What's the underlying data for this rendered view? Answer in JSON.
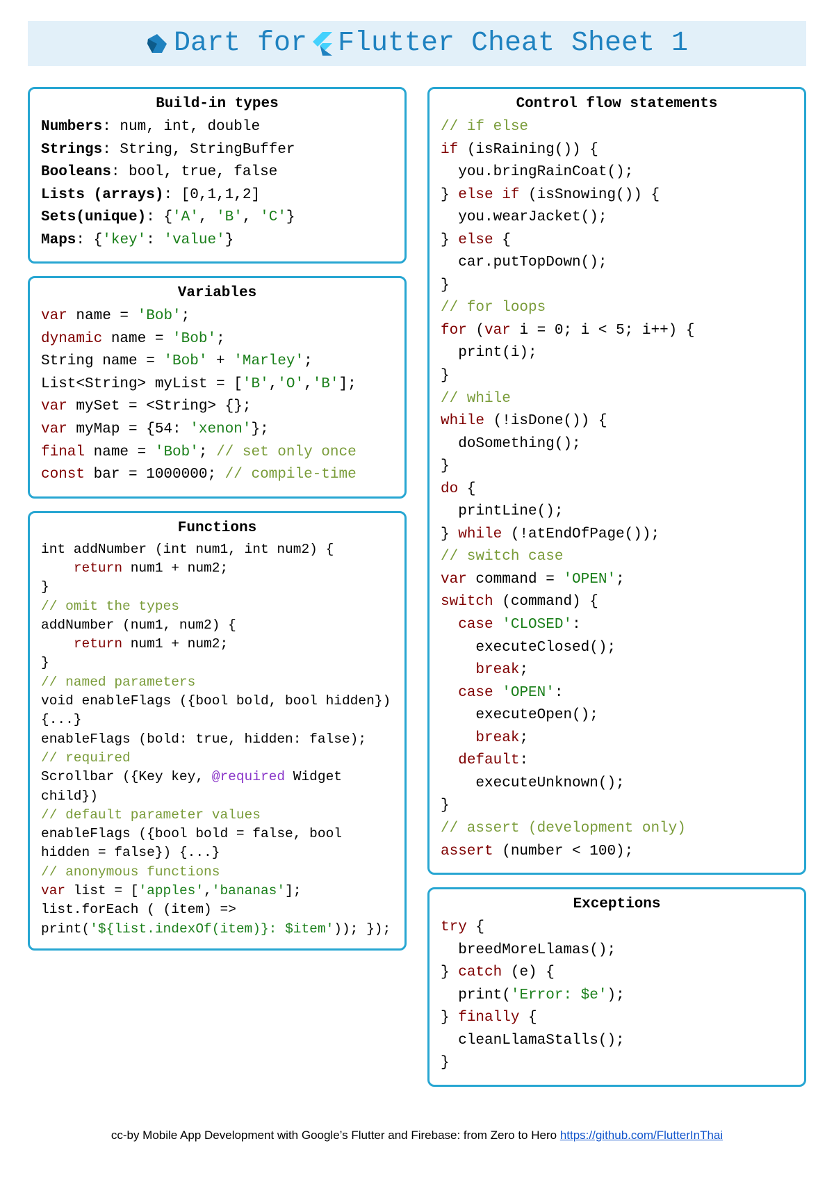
{
  "title": {
    "part1": "Dart for",
    "part2": "Flutter Cheat Sheet 1"
  },
  "boxes": {
    "builtin": {
      "title": "Build-in types",
      "lines": [
        [
          {
            "t": "Numbers",
            "b": true
          },
          {
            "t": ": num, int, double"
          }
        ],
        [
          {
            "t": "Strings",
            "b": true
          },
          {
            "t": ": String, StringBuffer"
          }
        ],
        [
          {
            "t": "Booleans",
            "b": true
          },
          {
            "t": ": bool, true, false"
          }
        ],
        [
          {
            "t": "Lists (arrays)",
            "b": true
          },
          {
            "t": ": [0,1,1,2]"
          }
        ],
        [
          {
            "t": "Sets(unique)",
            "b": true
          },
          {
            "t": ": {"
          },
          {
            "t": "'A'",
            "c": "str"
          },
          {
            "t": ", "
          },
          {
            "t": "'B'",
            "c": "str"
          },
          {
            "t": ", "
          },
          {
            "t": "'C'",
            "c": "str"
          },
          {
            "t": "}"
          }
        ],
        [
          {
            "t": "Maps",
            "b": true
          },
          {
            "t": ": {"
          },
          {
            "t": "'key'",
            "c": "str"
          },
          {
            "t": ": "
          },
          {
            "t": "'value'",
            "c": "str"
          },
          {
            "t": "}"
          }
        ]
      ]
    },
    "variables": {
      "title": "Variables",
      "lines": [
        [
          {
            "t": "var",
            "c": "kw"
          },
          {
            "t": " name = "
          },
          {
            "t": "'Bob'",
            "c": "str"
          },
          {
            "t": ";"
          }
        ],
        [
          {
            "t": "dynamic",
            "c": "kw"
          },
          {
            "t": " name = "
          },
          {
            "t": "'Bob'",
            "c": "str"
          },
          {
            "t": ";"
          }
        ],
        [
          {
            "t": "String name = "
          },
          {
            "t": "'Bob'",
            "c": "str"
          },
          {
            "t": " + "
          },
          {
            "t": "'Marley'",
            "c": "str"
          },
          {
            "t": ";"
          }
        ],
        [
          {
            "t": "List<String> myList = ["
          },
          {
            "t": "'B'",
            "c": "str"
          },
          {
            "t": ","
          },
          {
            "t": "'O'",
            "c": "str"
          },
          {
            "t": ","
          },
          {
            "t": "'B'",
            "c": "str"
          },
          {
            "t": "];"
          }
        ],
        [
          {
            "t": "var",
            "c": "kw"
          },
          {
            "t": " mySet = <String> {};"
          }
        ],
        [
          {
            "t": "var",
            "c": "kw"
          },
          {
            "t": " myMap = {54: "
          },
          {
            "t": "'xenon'",
            "c": "str"
          },
          {
            "t": "};"
          }
        ],
        [
          {
            "t": "final",
            "c": "kw"
          },
          {
            "t": " name = "
          },
          {
            "t": "'Bob'",
            "c": "str"
          },
          {
            "t": "; "
          },
          {
            "t": "// set only once",
            "c": "cm"
          }
        ],
        [
          {
            "t": "const",
            "c": "kw"
          },
          {
            "t": " bar = 1000000; "
          },
          {
            "t": "// compile-time",
            "c": "cm"
          }
        ]
      ]
    },
    "functions": {
      "title": "Functions",
      "lines": [
        [
          {
            "t": "int addNumber (int num1, int num2) {"
          }
        ],
        [
          {
            "t": "    "
          },
          {
            "t": "return",
            "c": "kw"
          },
          {
            "t": " num1 + num2;"
          }
        ],
        [
          {
            "t": "}"
          }
        ],
        [
          {
            "t": "// omit the types",
            "c": "cm"
          }
        ],
        [
          {
            "t": "addNumber (num1, num2) {"
          }
        ],
        [
          {
            "t": "    "
          },
          {
            "t": "return",
            "c": "kw"
          },
          {
            "t": " num1 + num2;"
          }
        ],
        [
          {
            "t": "}"
          }
        ],
        [
          {
            "t": "// named parameters",
            "c": "cm"
          }
        ],
        [
          {
            "t": "void enableFlags ({bool bold, bool hidden}) {...}"
          }
        ],
        [
          {
            "t": "enableFlags (bold: true, hidden: false);"
          }
        ],
        [
          {
            "t": "// required",
            "c": "cm"
          }
        ],
        [
          {
            "t": "Scrollbar ({Key key, "
          },
          {
            "t": "@required",
            "c": "at"
          },
          {
            "t": " Widget child})"
          }
        ],
        [
          {
            "t": "// default parameter values",
            "c": "cm"
          }
        ],
        [
          {
            "t": "enableFlags ({bool bold = false, bool hidden = false}) {...}"
          }
        ],
        [
          {
            "t": "// anonymous functions",
            "c": "cm"
          }
        ],
        [
          {
            "t": "var",
            "c": "kw"
          },
          {
            "t": " list = ["
          },
          {
            "t": "'apples'",
            "c": "str"
          },
          {
            "t": ","
          },
          {
            "t": "'bananas'",
            "c": "str"
          },
          {
            "t": "];"
          }
        ],
        [
          {
            "t": "list.forEach ( (item) => print("
          },
          {
            "t": "'${list.indexOf(item)}: $item'",
            "c": "str"
          },
          {
            "t": ")); });"
          }
        ]
      ]
    },
    "control": {
      "title": "Control flow statements",
      "lines": [
        [
          {
            "t": "// if else",
            "c": "cm"
          }
        ],
        [
          {
            "t": "if",
            "c": "kw"
          },
          {
            "t": " (isRaining()) {"
          }
        ],
        [
          {
            "t": "  you.bringRainCoat();"
          }
        ],
        [
          {
            "t": "} "
          },
          {
            "t": "else if",
            "c": "kw"
          },
          {
            "t": " (isSnowing()) {"
          }
        ],
        [
          {
            "t": "  you.wearJacket();"
          }
        ],
        [
          {
            "t": "} "
          },
          {
            "t": "else",
            "c": "kw"
          },
          {
            "t": " {"
          }
        ],
        [
          {
            "t": "  car.putTopDown();"
          }
        ],
        [
          {
            "t": "}"
          }
        ],
        [
          {
            "t": "// for loops",
            "c": "cm"
          }
        ],
        [
          {
            "t": "for",
            "c": "kw"
          },
          {
            "t": " ("
          },
          {
            "t": "var",
            "c": "kw"
          },
          {
            "t": " i = 0; i < 5; i++) {"
          }
        ],
        [
          {
            "t": "  print(i);"
          }
        ],
        [
          {
            "t": "}"
          }
        ],
        [
          {
            "t": "// while",
            "c": "cm"
          }
        ],
        [
          {
            "t": "while",
            "c": "kw"
          },
          {
            "t": " (!isDone()) {"
          }
        ],
        [
          {
            "t": "  doSomething();"
          }
        ],
        [
          {
            "t": "}"
          }
        ],
        [
          {
            "t": "do",
            "c": "kw"
          },
          {
            "t": " {"
          }
        ],
        [
          {
            "t": "  printLine();"
          }
        ],
        [
          {
            "t": "} "
          },
          {
            "t": "while",
            "c": "kw"
          },
          {
            "t": " (!atEndOfPage());"
          }
        ],
        [
          {
            "t": "// switch case",
            "c": "cm"
          }
        ],
        [
          {
            "t": "var",
            "c": "kw"
          },
          {
            "t": " command = "
          },
          {
            "t": "'OPEN'",
            "c": "str"
          },
          {
            "t": ";"
          }
        ],
        [
          {
            "t": "switch",
            "c": "kw"
          },
          {
            "t": " (command) {"
          }
        ],
        [
          {
            "t": "  "
          },
          {
            "t": "case",
            "c": "kw"
          },
          {
            "t": " "
          },
          {
            "t": "'CLOSED'",
            "c": "str"
          },
          {
            "t": ":"
          }
        ],
        [
          {
            "t": "    executeClosed();"
          }
        ],
        [
          {
            "t": "    "
          },
          {
            "t": "break",
            "c": "kw"
          },
          {
            "t": ";"
          }
        ],
        [
          {
            "t": "  "
          },
          {
            "t": "case",
            "c": "kw"
          },
          {
            "t": " "
          },
          {
            "t": "'OPEN'",
            "c": "str"
          },
          {
            "t": ":"
          }
        ],
        [
          {
            "t": "    executeOpen();"
          }
        ],
        [
          {
            "t": "    "
          },
          {
            "t": "break",
            "c": "kw"
          },
          {
            "t": ";"
          }
        ],
        [
          {
            "t": "  "
          },
          {
            "t": "default",
            "c": "kw"
          },
          {
            "t": ":"
          }
        ],
        [
          {
            "t": "    executeUnknown();"
          }
        ],
        [
          {
            "t": "}"
          }
        ],
        [
          {
            "t": "// assert (development only)",
            "c": "cm"
          }
        ],
        [
          {
            "t": "assert",
            "c": "kw"
          },
          {
            "t": " (number < 100);"
          }
        ]
      ]
    },
    "exceptions": {
      "title": "Exceptions",
      "lines": [
        [
          {
            "t": "try",
            "c": "kw"
          },
          {
            "t": " {"
          }
        ],
        [
          {
            "t": "  breedMoreLlamas();"
          }
        ],
        [
          {
            "t": "} "
          },
          {
            "t": "catch",
            "c": "kw"
          },
          {
            "t": " (e) {"
          }
        ],
        [
          {
            "t": "  print("
          },
          {
            "t": "'Error: $e'",
            "c": "str"
          },
          {
            "t": ");"
          }
        ],
        [
          {
            "t": "} "
          },
          {
            "t": "finally",
            "c": "kw"
          },
          {
            "t": " {"
          }
        ],
        [
          {
            "t": "  cleanLlamaStalls();"
          }
        ],
        [
          {
            "t": "}"
          }
        ]
      ]
    }
  },
  "footer": {
    "text": "cc-by Mobile App Development with Google’s Flutter and Firebase: from Zero to Hero ",
    "link_text": "https://github.com/FlutterInThai",
    "link_href": "https://github.com/FlutterInThai"
  }
}
